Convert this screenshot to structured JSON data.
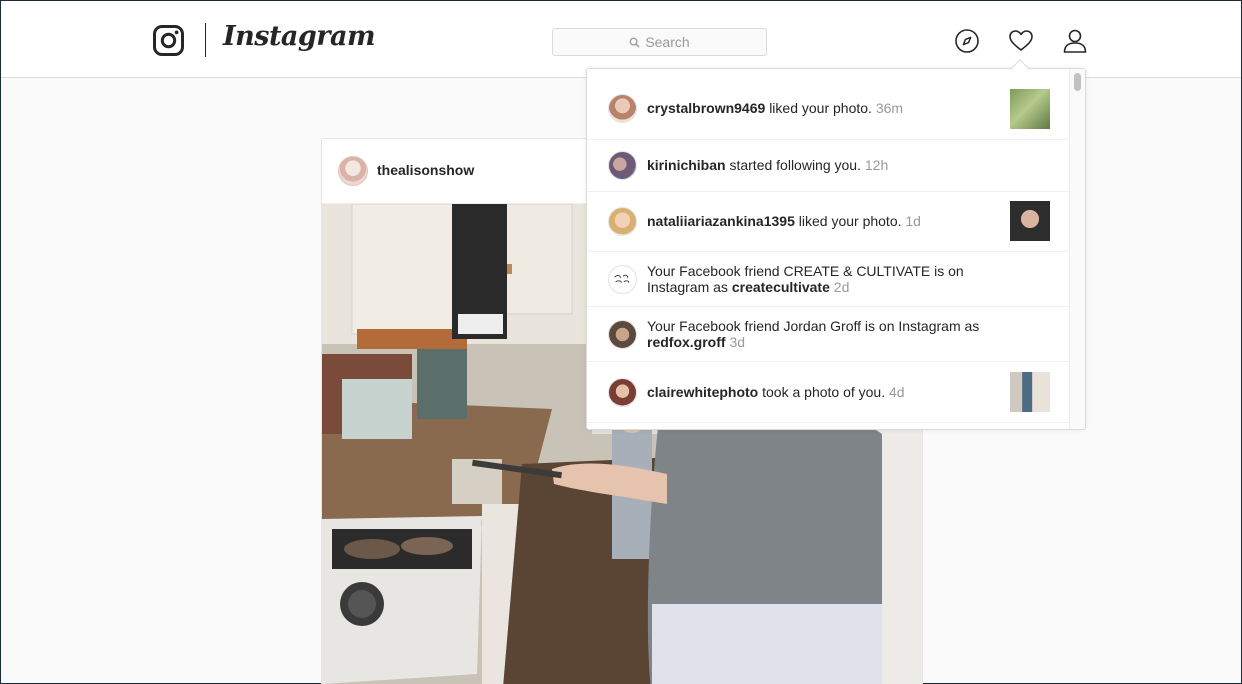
{
  "header": {
    "wordmark": "Instagram",
    "search_placeholder": "Search",
    "icons": [
      "instagram-glyph-icon",
      "search-icon",
      "explore-compass-icon",
      "heart-icon",
      "profile-icon"
    ]
  },
  "post": {
    "username": "thealisonshow"
  },
  "notifications": [
    {
      "username": "crystalbrown9469",
      "action": "liked your photo.",
      "time": "36m",
      "has_thumbnail": true
    },
    {
      "username": "kirinichiban",
      "action": "started following you.",
      "time": "12h",
      "has_thumbnail": false
    },
    {
      "username": "nataliiariazankina1395",
      "action": "liked your photo.",
      "time": "1d",
      "has_thumbnail": true
    },
    {
      "prefix": "Your Facebook friend CREATE & CULTIVATE is on Instagram as",
      "username": "createcultivate",
      "time": "2d",
      "has_thumbnail": false
    },
    {
      "prefix": "Your Facebook friend Jordan Groff is on Instagram as",
      "username": "redfox.groff",
      "time": "3d",
      "has_thumbnail": false
    },
    {
      "username": "clairewhitephoto",
      "action": "took a photo of you.",
      "time": "4d",
      "has_thumbnail": true
    }
  ],
  "colors": {
    "text_primary": "#262626",
    "text_secondary": "#999999",
    "border": "#dbdbdb",
    "background": "#fafafa"
  }
}
